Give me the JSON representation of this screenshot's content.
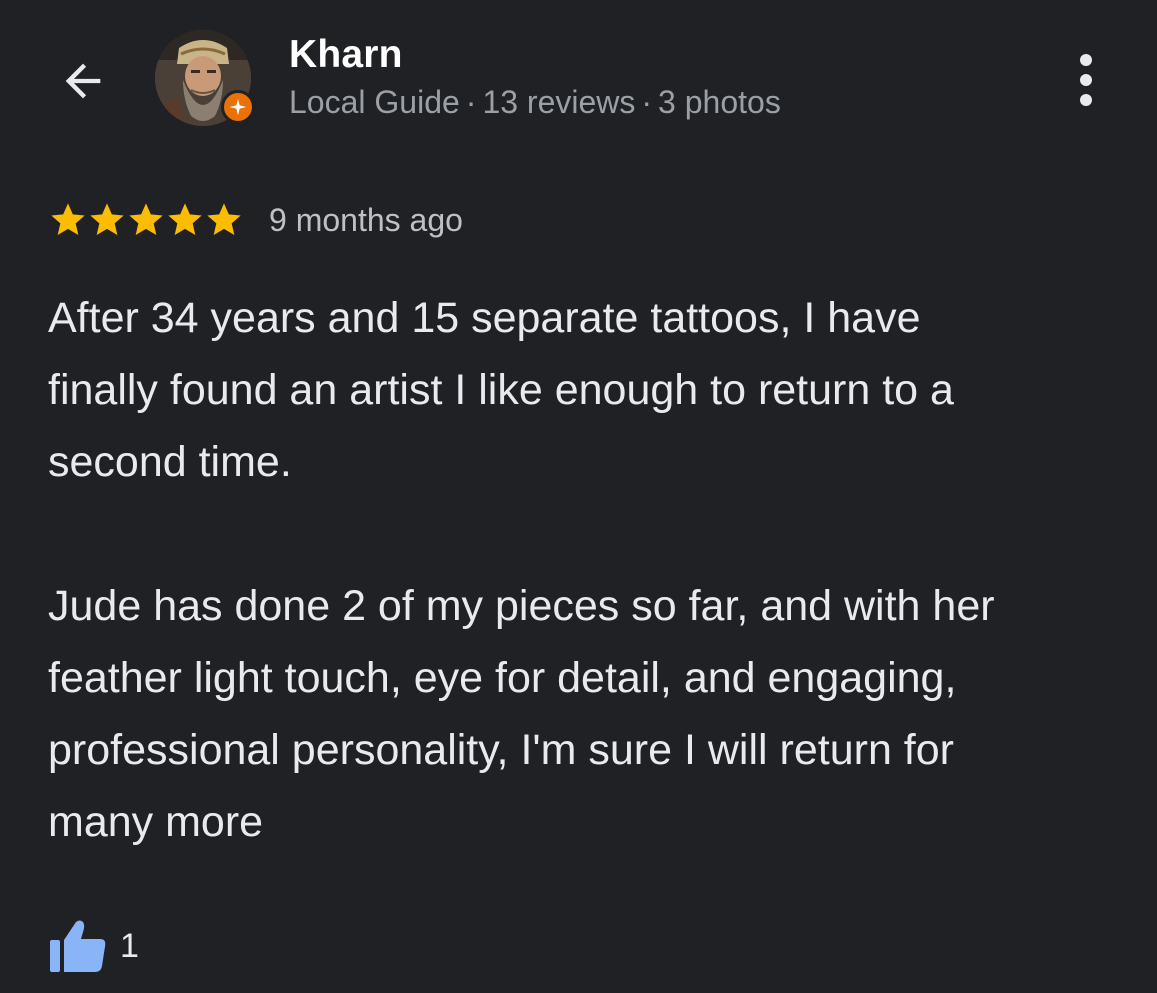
{
  "header": {
    "back_icon": "arrow-back-icon",
    "user_name": "Kharn",
    "badge_icon": "local-guide-badge-icon",
    "meta": {
      "level": "Local Guide",
      "reviews": "13 reviews",
      "photos": "3 photos",
      "separator": "·"
    },
    "more_icon": "more-vert-icon"
  },
  "review": {
    "rating": 5,
    "rating_max": 5,
    "time": "9 months ago",
    "text": "After 34 years and 15 separate tattoos, I have\nfinally found an artist I like enough to return to a\nsecond time.\n\nJude has done 2 of my pieces so far, and with her\nfeather light touch, eye for detail, and engaging,\nprofessional personality, I'm sure I will return for\nmany more",
    "likes": "1",
    "like_icon": "thumbs-up-icon"
  },
  "colors": {
    "background": "#202124",
    "star": "#fbbc04",
    "like": "#8ab4f8",
    "badge": "#e8710a"
  }
}
